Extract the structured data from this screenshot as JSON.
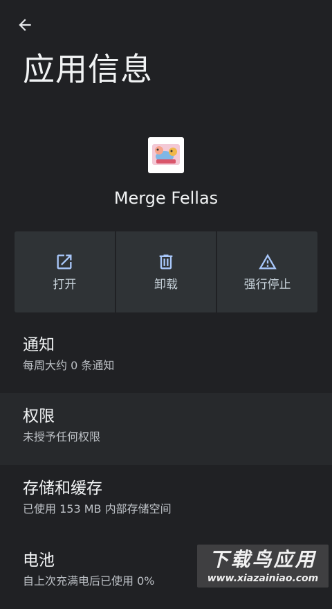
{
  "header": {
    "back_icon": "arrow-back-icon",
    "title": "应用信息"
  },
  "app": {
    "name": "Merge Fellas",
    "icon": "app-icon"
  },
  "actions": [
    {
      "label": "打开",
      "icon": "open-in-new-icon"
    },
    {
      "label": "卸载",
      "icon": "trash-icon"
    },
    {
      "label": "强行停止",
      "icon": "warning-icon"
    }
  ],
  "settings": [
    {
      "title": "通知",
      "summary": "每周大约 0 条通知"
    },
    {
      "title": "权限",
      "summary": "未授予任何权限"
    },
    {
      "title": "存储和缓存",
      "summary": "已使用 153 MB 内部存储空间"
    },
    {
      "title": "电池",
      "summary": "自上次充满电后已使用 0%"
    }
  ],
  "watermark": {
    "title": "下载鸟应用",
    "url": "www.xiazainiao.com"
  },
  "colors": {
    "background": "#202124",
    "button_bg": "#2f3336",
    "highlight_row": "#27292c",
    "accent_icon": "#a8c7fa"
  }
}
